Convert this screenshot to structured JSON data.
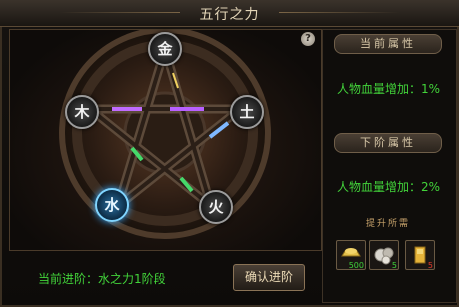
{
  "window": {
    "title": "五行之力"
  },
  "help_label": "?",
  "elements": [
    {
      "id": "metal",
      "label": "金",
      "active": false
    },
    {
      "id": "wood",
      "label": "木",
      "active": false
    },
    {
      "id": "earth",
      "label": "土",
      "active": false
    },
    {
      "id": "water",
      "label": "水",
      "active": true
    },
    {
      "id": "fire",
      "label": "火",
      "active": false
    }
  ],
  "current": {
    "header": "当前属性",
    "text": "人物血量增加：1%"
  },
  "next": {
    "header": "下阶属性",
    "text": "人物血量增加：2%"
  },
  "recommend_label": "提升所需",
  "items": [
    {
      "name": "gold-ingot",
      "count": "500",
      "count_color": "#3fd23a"
    },
    {
      "name": "silver-ore",
      "count": "5",
      "count_color": "#3fd23a"
    },
    {
      "name": "gold-bar",
      "count": "5",
      "count_color": "#e23a2a"
    }
  ],
  "progress_text": "当前进阶：水之力1阶段",
  "confirm_label": "确认进阶",
  "colors": {
    "accent_green": "#42d33a",
    "water_glow": "#39aaff"
  }
}
